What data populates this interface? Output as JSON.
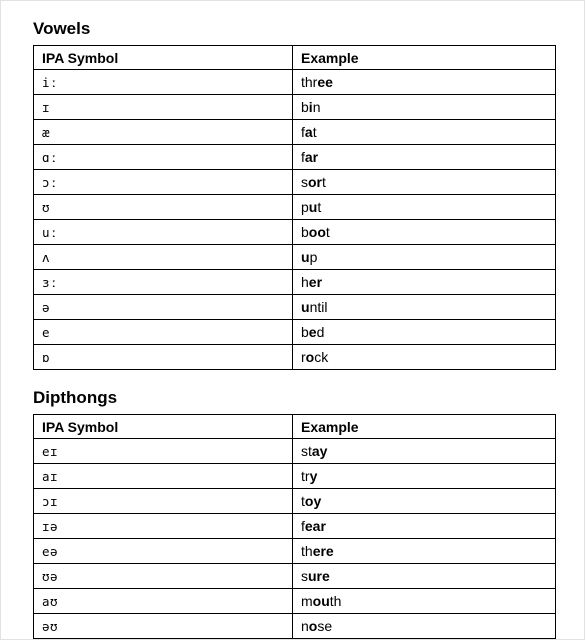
{
  "page": {
    "background_color": "#ffffff",
    "border_color": "#e2e2e2",
    "text_color": "#000000",
    "rule_color": "#000000"
  },
  "sections": [
    {
      "id": "vowels",
      "title": "Vowels",
      "columns": [
        "IPA Symbol",
        "Example"
      ],
      "rows": [
        {
          "symbol": "iː",
          "example": "three",
          "plain_before": "thr",
          "bold": "ee",
          "plain_after": ""
        },
        {
          "symbol": "ɪ",
          "example": "bin",
          "plain_before": "b",
          "bold": "i",
          "plain_after": "n"
        },
        {
          "symbol": "æ",
          "example": "fat",
          "plain_before": "f",
          "bold": "a",
          "plain_after": "t"
        },
        {
          "symbol": "ɑː",
          "example": "far",
          "plain_before": "f",
          "bold": "ar",
          "plain_after": ""
        },
        {
          "symbol": "ɔː",
          "example": "sort",
          "plain_before": "s",
          "bold": "or",
          "plain_after": "t"
        },
        {
          "symbol": "ʊ",
          "example": "put",
          "plain_before": "p",
          "bold": "u",
          "plain_after": "t"
        },
        {
          "symbol": "uː",
          "example": "boot",
          "plain_before": "b",
          "bold": "oo",
          "plain_after": "t"
        },
        {
          "symbol": "ʌ",
          "example": "up",
          "plain_before": "",
          "bold": "u",
          "plain_after": "p"
        },
        {
          "symbol": "ɜː",
          "example": "her",
          "plain_before": "h",
          "bold": "er",
          "plain_after": ""
        },
        {
          "symbol": "ə",
          "example": "until",
          "plain_before": "",
          "bold": "u",
          "plain_after": "ntil"
        },
        {
          "symbol": "e",
          "example": "bed",
          "plain_before": "b",
          "bold": "e",
          "plain_after": "d"
        },
        {
          "symbol": "ɒ",
          "example": "rock",
          "plain_before": "r",
          "bold": "o",
          "plain_after": "ck"
        }
      ]
    },
    {
      "id": "dipthongs",
      "title": "Dipthongs",
      "columns": [
        "IPA Symbol",
        "Example"
      ],
      "rows": [
        {
          "symbol": "eɪ",
          "example": "stay",
          "plain_before": "st",
          "bold": "ay",
          "plain_after": ""
        },
        {
          "symbol": "aɪ",
          "example": "try",
          "plain_before": "tr",
          "bold": "y",
          "plain_after": ""
        },
        {
          "symbol": "ɔɪ",
          "example": "toy",
          "plain_before": "t",
          "bold": "oy",
          "plain_after": ""
        },
        {
          "symbol": "ɪə",
          "example": "fear",
          "plain_before": "f",
          "bold": "ear",
          "plain_after": ""
        },
        {
          "symbol": "eə",
          "example": "there",
          "plain_before": "th",
          "bold": "ere",
          "plain_after": ""
        },
        {
          "symbol": "ʊə",
          "example": "sure",
          "plain_before": "s",
          "bold": "ure",
          "plain_after": ""
        },
        {
          "symbol": "aʊ",
          "example": "mouth",
          "plain_before": "m",
          "bold": "ou",
          "plain_after": "th"
        },
        {
          "symbol": "əʊ",
          "example": "nose",
          "plain_before": "n",
          "bold": "o",
          "plain_after": "se"
        }
      ]
    }
  ]
}
